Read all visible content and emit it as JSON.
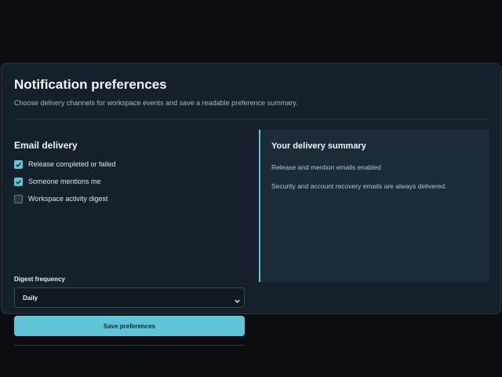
{
  "page": {
    "title": "Notification preferences",
    "subtitle": "Choose delivery channels for workspace events and save a readable preference summary."
  },
  "email": {
    "section_title": "Email delivery",
    "options": [
      {
        "label": "Release completed or failed",
        "checked": true
      },
      {
        "label": "Someone mentions me",
        "checked": true
      },
      {
        "label": "Workspace activity digest",
        "checked": false
      }
    ],
    "digest_label": "Digest frequency",
    "digest_value": "Daily",
    "save_label": "Save preferences"
  },
  "summary": {
    "title": "Your delivery summary",
    "line1": "Release and mention emails enabled",
    "line2": "Security and account recovery emails are always delivered."
  },
  "colors": {
    "accent": "#5fc4d6",
    "card_bg": "#16202a",
    "page_bg": "#0b0d10"
  }
}
